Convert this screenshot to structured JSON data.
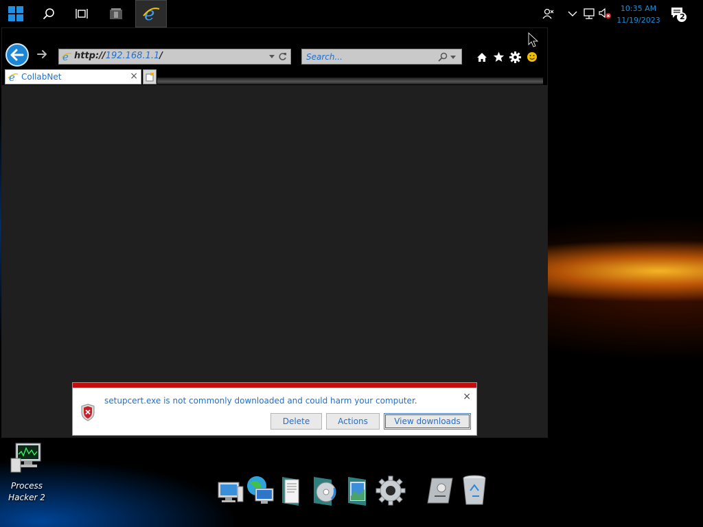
{
  "taskbar": {
    "buttons": [
      "start-icon",
      "search-icon",
      "task-view-icon",
      "app-icon",
      "internet-explorer-icon"
    ],
    "clock": {
      "time": "10:35 AM",
      "date": "11/19/2023"
    },
    "notification_count": "2"
  },
  "browser": {
    "address": {
      "scheme": "http://",
      "host": "192.168.1.1",
      "path": "/"
    },
    "search_placeholder": "Search...",
    "tab": {
      "title": "CollabNet"
    }
  },
  "notification": {
    "message": "setupcert.exe is not commonly downloaded and could harm your computer.",
    "buttons": {
      "delete": "Delete",
      "actions": "Actions",
      "view_downloads": "View downloads"
    }
  },
  "desktop": {
    "icons": [
      {
        "label_line1": "Process",
        "label_line2": "Hacker 2"
      }
    ]
  },
  "colors": {
    "accent": "#1e8ed8",
    "link": "#1e6fd0",
    "warning_red": "#c20e0e"
  }
}
